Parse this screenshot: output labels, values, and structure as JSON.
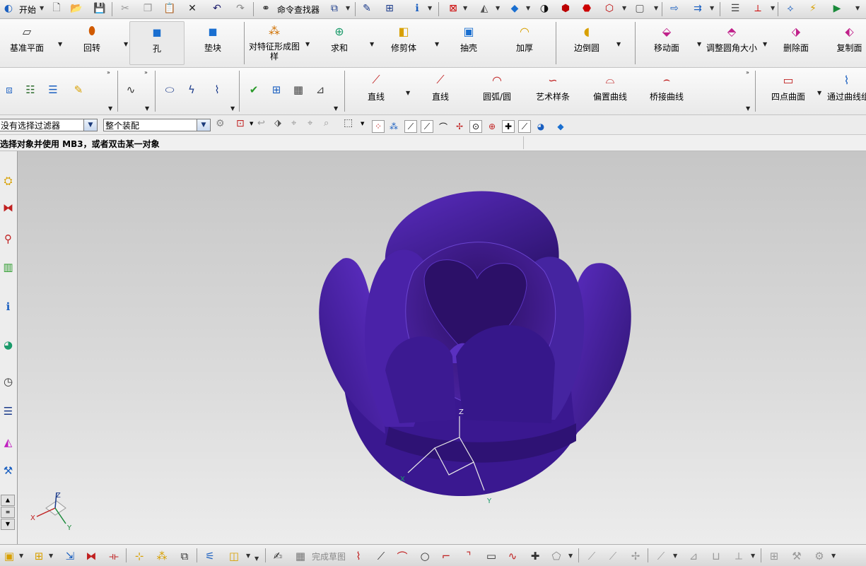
{
  "top_toolbar": {
    "start_label": "开始",
    "command_finder_label": "命令查找器"
  },
  "feature_ribbon": {
    "items": [
      {
        "label": "基准平面"
      },
      {
        "label": "回转"
      },
      {
        "label": "孔"
      },
      {
        "label": "垫块"
      },
      {
        "label": "对特征形成图样"
      },
      {
        "label": "求和"
      },
      {
        "label": "修剪体"
      },
      {
        "label": "抽壳"
      },
      {
        "label": "加厚"
      },
      {
        "label": "边倒圆"
      },
      {
        "label": "移动面"
      },
      {
        "label": "调整圆角大小"
      },
      {
        "label": "删除面"
      },
      {
        "label": "复制面"
      }
    ]
  },
  "curve_ribbon": {
    "items": [
      {
        "label": "直线"
      },
      {
        "label": "直线"
      },
      {
        "label": "圆弧/圆"
      },
      {
        "label": "艺术样条"
      },
      {
        "label": "偏置曲线"
      },
      {
        "label": "桥接曲线"
      },
      {
        "label": "四点曲面"
      },
      {
        "label": "通过曲线组"
      }
    ]
  },
  "selection_bar": {
    "filter_value": "没有选择过滤器",
    "scope_value": "整个装配"
  },
  "status": {
    "prompt": "选择对象并使用 MB3，或者双击某一对象"
  },
  "viewport": {
    "model_color": "#4a22a0",
    "csys_labels": {
      "x": "X",
      "y": "Y",
      "z": "Z"
    },
    "triad_labels": {
      "x": "X",
      "y": "Y",
      "z": "Z"
    }
  },
  "bottom_toolbar": {
    "finish_sketch_label": "完成草图"
  },
  "icons": [
    "start-icon",
    "new-file-icon",
    "open-folder-icon",
    "save-icon",
    "cut-icon",
    "copy-icon",
    "paste-icon",
    "delete-icon",
    "undo-icon",
    "redo-icon",
    "binoculars-icon"
  ]
}
